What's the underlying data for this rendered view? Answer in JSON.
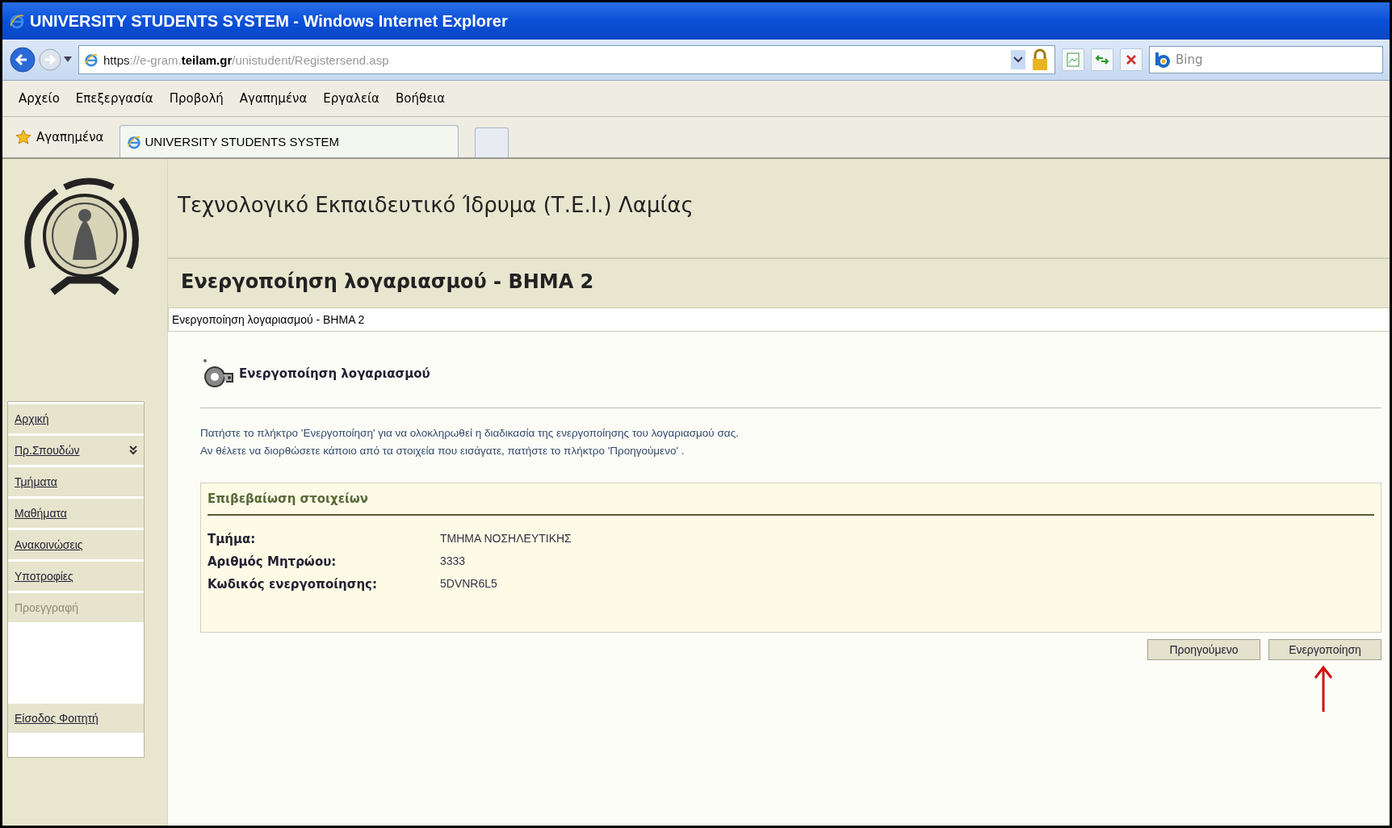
{
  "window": {
    "title": "UNIVERSITY STUDENTS SYSTEM - Windows Internet Explorer"
  },
  "address_bar": {
    "scheme": "https",
    "host_prefix": "://e-gram.",
    "host": "teilam.gr",
    "path": "/unistudent/Registersend.asp"
  },
  "search": {
    "placeholder": "Bing"
  },
  "menu": [
    "Αρχείο",
    "Επεξεργασία",
    "Προβολή",
    "Αγαπημένα",
    "Εργαλεία",
    "Βοήθεια"
  ],
  "favorites": {
    "label": "Αγαπημένα"
  },
  "tabs": [
    {
      "label": "UNIVERSITY STUDENTS SYSTEM",
      "selected": true
    }
  ],
  "site": {
    "title": "Τεχνολογικό Εκπαιδευτικό Ίδρυμα (Τ.Ε.Ι.) Λαμίας",
    "page_heading": "Ενεργοποίηση λογαριασμού - ΒΗΜΑ 2",
    "breadcrumb": "Ενεργοποίηση λογαριασμού - ΒΗΜΑ 2"
  },
  "sidebar": {
    "items": [
      {
        "label": "Αρχική",
        "disabled": false,
        "expandable": false
      },
      {
        "label": "Πρ.Σπουδών",
        "disabled": false,
        "expandable": true
      },
      {
        "label": "Τμήματα",
        "disabled": false,
        "expandable": false
      },
      {
        "label": "Μαθήματα",
        "disabled": false,
        "expandable": false
      },
      {
        "label": "Ανακοινώσεις",
        "disabled": false,
        "expandable": false
      },
      {
        "label": "Υποτροφίες",
        "disabled": false,
        "expandable": false
      },
      {
        "label": "Προεγγραφή",
        "disabled": true,
        "expandable": false
      }
    ],
    "login": "Είσοδος Φοιτητή"
  },
  "content": {
    "section_title": "Ενεργοποίηση λογαριασμού",
    "instructions": [
      "Πατήστε το πλήκτρο 'Ενεργοποίηση' για να ολοκληρωθεί η διαδικασία της ενεργοποίησης του λογαριασμού σας.",
      "Αν θέλετε να διορθώσετε κάποιο από τα στοιχεία που εισάγατε, πατήστε το πλήκτρο 'Προηγούμενο' ."
    ],
    "confirmation": {
      "title": "Επιβεβαίωση στοιχείων",
      "rows": [
        {
          "label": "Τμήμα:",
          "value": "ΤΜΗΜΑ ΝΟΣΗΛΕΥΤΙΚΗΣ"
        },
        {
          "label": "Αριθμός Μητρώου:",
          "value": "3333"
        },
        {
          "label": "Κωδικός ενεργοποίησης:",
          "value": "5DVNR6L5"
        }
      ]
    },
    "buttons": [
      "Προηγούμενο",
      "Ενεργοποίηση"
    ]
  }
}
